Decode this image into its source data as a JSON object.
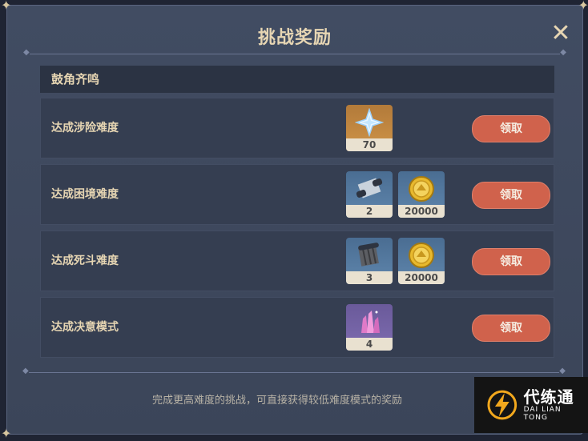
{
  "dialog": {
    "title": "挑战奖励",
    "close_icon": "close-icon",
    "section_title": "鼓角齐鸣",
    "footer_note": "完成更高难度的挑战，可直接获得较低难度模式的奖励"
  },
  "rows": [
    {
      "label": "达成涉险难度",
      "claim": "领取",
      "items": [
        {
          "icon": "primogem-icon",
          "qty": "70",
          "rarity": "gold"
        }
      ]
    },
    {
      "label": "达成困境难度",
      "claim": "领取",
      "items": [
        {
          "icon": "scroll-icon",
          "qty": "2",
          "rarity": "blue"
        },
        {
          "icon": "mora-coin-icon",
          "qty": "20000",
          "rarity": "blue"
        }
      ]
    },
    {
      "label": "达成死斗难度",
      "claim": "领取",
      "items": [
        {
          "icon": "scroll-icon",
          "qty": "3",
          "rarity": "blue"
        },
        {
          "icon": "mora-coin-icon",
          "qty": "20000",
          "rarity": "blue"
        }
      ]
    },
    {
      "label": "达成决意模式",
      "claim": "领取",
      "items": [
        {
          "icon": "crystal-icon",
          "qty": "4",
          "rarity": "purple"
        }
      ]
    }
  ],
  "watermark": {
    "main": "代练通",
    "sub": "DAI LIAN TONG"
  },
  "colors": {
    "claim_button": "#d0624c",
    "title_text": "#e7d6b3",
    "panel": "#3f495e"
  }
}
